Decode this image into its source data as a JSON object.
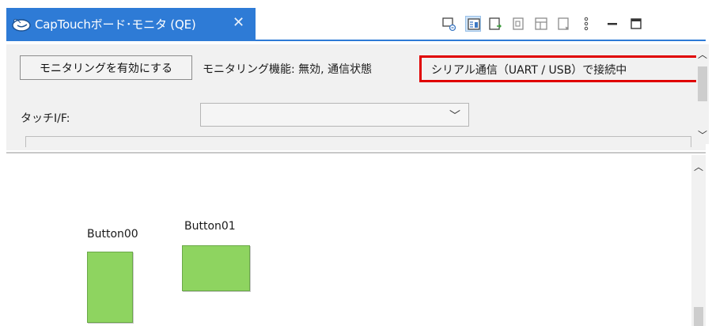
{
  "tab": {
    "title": "CapTouchボード･モニタ (QE)",
    "close_glyph": "✕",
    "active_color": "#2e7bd6"
  },
  "toolbar": {
    "icons": [
      "connect-icon",
      "monitor-view-icon",
      "export-icon",
      "import-icon",
      "layout-icon",
      "settings-icon",
      "more-icon",
      "minimize-icon",
      "maximize-icon"
    ]
  },
  "panel": {
    "enable_button_label": "モニタリングを有効にする",
    "status_text": "モニタリング機能: 無効, 通信状態",
    "serial_status": "シリアル通信（UART / USB）で接続中",
    "touch_if_label": "タッチI/F:",
    "touch_if_value": "",
    "highlight_color": "#e00000"
  },
  "canvas": {
    "buttons": [
      {
        "label": "Button00",
        "color": "#8ed460"
      },
      {
        "label": "Button01",
        "color": "#8ed460"
      }
    ]
  }
}
